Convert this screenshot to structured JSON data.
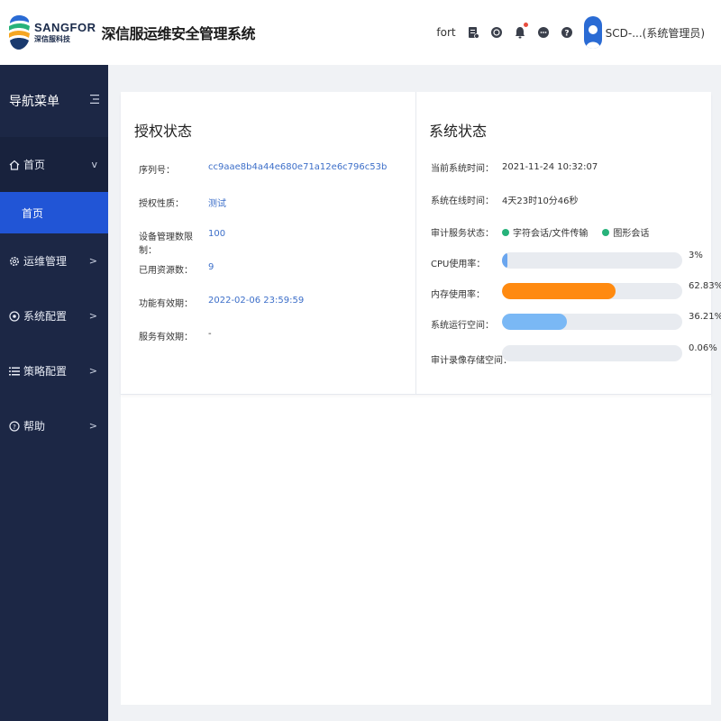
{
  "header": {
    "brand_en": "SANGFOR",
    "brand_cn": "深信服科技",
    "title": "深信服运维安全管理系统",
    "user_text": "fort",
    "account": "SCD-...(系统管理员)",
    "icons": [
      "document-icon",
      "clock-icon",
      "bell-icon",
      "chat-icon",
      "help-icon",
      "avatar"
    ]
  },
  "sidebar": {
    "heading": "导航菜单",
    "items": [
      {
        "label": "首页",
        "icon": "home-icon",
        "chevron": "v",
        "sub": "首页"
      },
      {
        "label": "运维管理",
        "icon": "gear-icon",
        "chevron": ">"
      },
      {
        "label": "系统配置",
        "icon": "settings-icon",
        "chevron": ">"
      },
      {
        "label": "策略配置",
        "icon": "list-icon",
        "chevron": ">"
      },
      {
        "label": "帮助",
        "icon": "help-icon",
        "chevron": ">"
      }
    ]
  },
  "license": {
    "title": "授权状态",
    "rows": [
      {
        "key": "序列号：",
        "value": "cc9aae8b4a44e680e71a12e6c796c53b"
      },
      {
        "key": "授权性质：",
        "value": "测试"
      },
      {
        "key": "设备管理数限制：",
        "value": "100"
      },
      {
        "key": "已用资源数：",
        "value": "9"
      },
      {
        "key": "功能有效期：",
        "value": "2022-02-06 23:59:59"
      },
      {
        "key": "服务有效期：",
        "value": "-"
      }
    ]
  },
  "system": {
    "title": "系统状态",
    "time_key": "当前系统时间：",
    "time_value": "2021-11-24 10:32:07",
    "uptime_key": "系统在线时间：",
    "uptime_value": "4天23时10分46秒",
    "service_key": "审计服务状态：",
    "services": [
      "字符会话/文件传输",
      "图形会话"
    ],
    "service_color": "#27b27a",
    "bars": [
      {
        "key": "CPU使用率：",
        "pct_label": "3%",
        "pct": 3,
        "color": "#6aa6ef"
      },
      {
        "key": "内存使用率：",
        "pct_label": "62.83%",
        "pct": 62.83,
        "color": "#ff8a10"
      },
      {
        "key": "系统运行空间：",
        "pct_label": "36.21%",
        "pct": 36.21,
        "color": "#7ab8f5"
      },
      {
        "key": "审计录像存储空间：",
        "pct_label": "0.06%",
        "pct": 0.06,
        "color": "#6aa6ef"
      }
    ]
  }
}
